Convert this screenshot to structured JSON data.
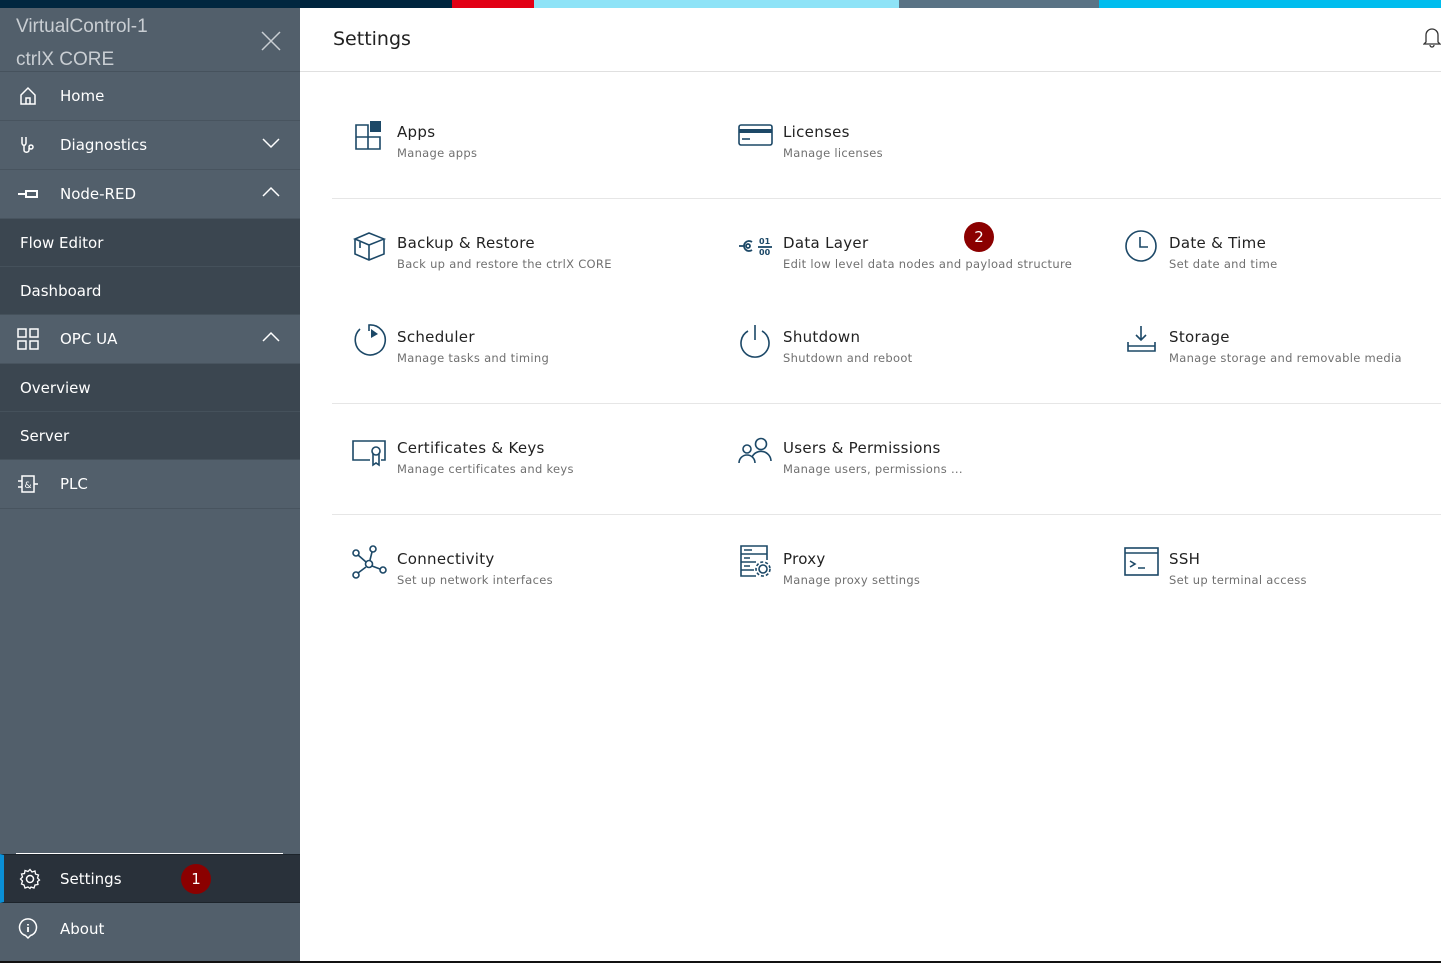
{
  "colors": {
    "strip": [
      "#00263f",
      "#e20015",
      "#8ee3f7",
      "#5a7385",
      "#00bdee"
    ],
    "sidebar": "#525f6b",
    "badge": "#8b0000",
    "icon": "#1c4867"
  },
  "sidebar": {
    "device": "VirtualControl-1",
    "product": "ctrlX CORE",
    "items": [
      {
        "label": "Home",
        "icon": "home-icon"
      },
      {
        "label": "Diagnostics",
        "icon": "stethoscope-icon"
      },
      {
        "label": "Node-RED",
        "icon": "node-red-icon"
      },
      {
        "label": "Flow Editor"
      },
      {
        "label": "Dashboard"
      },
      {
        "label": "OPC UA",
        "icon": "grid-icon"
      },
      {
        "label": "Overview"
      },
      {
        "label": "Server"
      },
      {
        "label": "PLC",
        "icon": "plc-icon"
      }
    ],
    "settings": "Settings",
    "about": "About",
    "badge1": "1"
  },
  "header": {
    "title": "Settings"
  },
  "badge2": "2",
  "items": [
    {
      "title": "Apps",
      "desc": "Manage apps"
    },
    {
      "title": "Licenses",
      "desc": "Manage licenses"
    },
    {
      "title": "Backup & Restore",
      "desc": "Back up and restore the ctrlX CORE"
    },
    {
      "title": "Data Layer",
      "desc": "Edit low level data nodes and payload structure"
    },
    {
      "title": "Date & Time",
      "desc": "Set date and time"
    },
    {
      "title": "Scheduler",
      "desc": "Manage tasks and timing"
    },
    {
      "title": "Shutdown",
      "desc": "Shutdown and reboot"
    },
    {
      "title": "Storage",
      "desc": "Manage storage and removable media"
    },
    {
      "title": "Certificates & Keys",
      "desc": "Manage certificates and keys"
    },
    {
      "title": "Users & Permissions",
      "desc": "Manage users, permissions ..."
    },
    {
      "title": "Connectivity",
      "desc": "Set up network interfaces"
    },
    {
      "title": "Proxy",
      "desc": "Manage proxy settings"
    },
    {
      "title": "SSH",
      "desc": "Set up terminal access"
    }
  ]
}
